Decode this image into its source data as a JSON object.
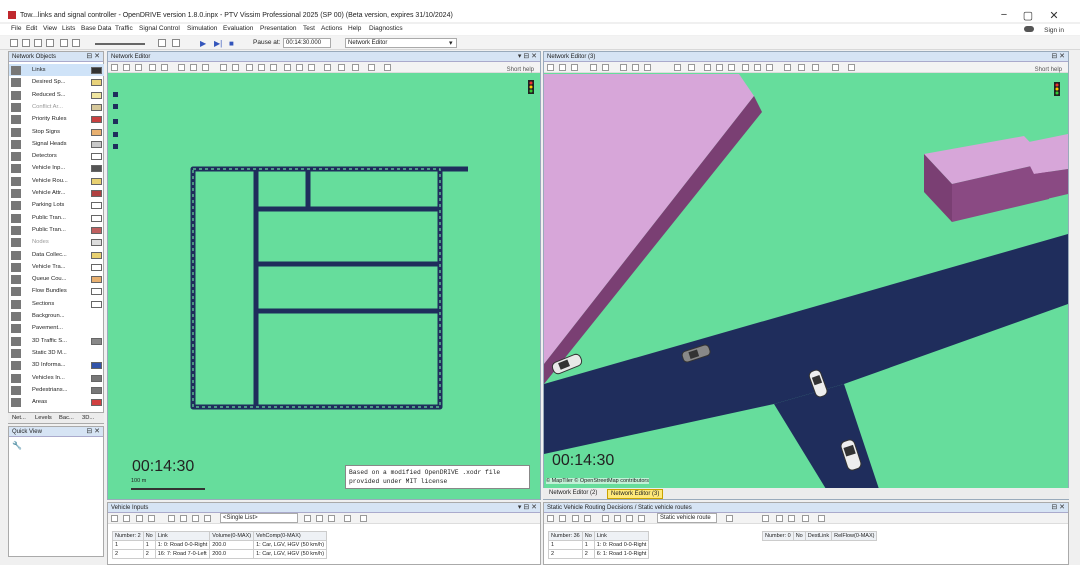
{
  "window": {
    "title": "Tow...links and signal controller - OpenDRIVE version 1.8.0.inpx - PTV Vissim Professional 2025 (SP 00) (Beta version, expires 31/10/2024)",
    "minimize": "−",
    "maximize": "▢",
    "close": "✕",
    "sign_in": "Sign in"
  },
  "menu": [
    "File",
    "Edit",
    "View",
    "Lists",
    "Base Data",
    "Traffic",
    "Signal Control",
    "Simulation",
    "Evaluation",
    "Presentation",
    "Test",
    "Actions",
    "Help",
    "Diagnostics"
  ],
  "toolbar": {
    "pause_label": "Pause at:",
    "pause_value": "00:14:30.000",
    "editor_select": "Network Editor"
  },
  "network_objects": {
    "title": "Network Objects",
    "items": [
      {
        "label": "Links",
        "swatch": "#333333",
        "icon": "links-icon",
        "selected": true
      },
      {
        "label": "Desired Sp...",
        "swatch": "#e8d27a",
        "icon": "desired-speed-icon"
      },
      {
        "label": "Reduced S...",
        "swatch": "#f0e6a0",
        "icon": "reduced-speed-icon"
      },
      {
        "label": "Conflict Ar...",
        "swatch": "#d6c89a",
        "icon": "conflict-area-icon",
        "dim": true
      },
      {
        "label": "Priority Rules",
        "swatch": "#c84040",
        "icon": "priority-rule-icon"
      },
      {
        "label": "Stop Signs",
        "swatch": "#e8b070",
        "icon": "stop-sign-icon"
      },
      {
        "label": "Signal Heads",
        "swatch": "#c8c8c8",
        "icon": "signal-head-icon"
      },
      {
        "label": "Detectors",
        "swatch": "#ffffff",
        "icon": "detector-icon"
      },
      {
        "label": "Vehicle Inp...",
        "swatch": "#555555",
        "icon": "vehicle-input-icon"
      },
      {
        "label": "Vehicle Rou...",
        "swatch": "#e8d070",
        "icon": "vehicle-route-icon"
      },
      {
        "label": "Vehicle Attr...",
        "swatch": "#b04040",
        "icon": "vehicle-attr-icon"
      },
      {
        "label": "Parking Lots",
        "swatch": "#ffffff",
        "icon": "parking-icon"
      },
      {
        "label": "Public Tran...",
        "swatch": "#ffffff",
        "icon": "public-transport-stop-icon"
      },
      {
        "label": "Public Tran...",
        "swatch": "#c06060",
        "icon": "public-transport-line-icon"
      },
      {
        "label": "Nodes",
        "swatch": "#dddddd",
        "icon": "nodes-icon",
        "dim": true
      },
      {
        "label": "Data Collec...",
        "swatch": "#e8d070",
        "icon": "data-collection-icon"
      },
      {
        "label": "Vehicle Tra...",
        "swatch": "#ffffff",
        "icon": "vehicle-travel-icon"
      },
      {
        "label": "Queue Cou...",
        "swatch": "#e8b070",
        "icon": "queue-counter-icon"
      },
      {
        "label": "Flow Bundles",
        "swatch": "#ffffff",
        "icon": "flow-bundle-icon"
      },
      {
        "label": "Sections",
        "swatch": "#ffffff",
        "icon": "sections-icon"
      },
      {
        "label": "Backgroun...",
        "swatch": "",
        "icon": "background-icon"
      },
      {
        "label": "Pavement...",
        "swatch": "",
        "icon": "pavement-icon"
      },
      {
        "label": "3D Traffic S...",
        "swatch": "#888888",
        "icon": "traffic-signal-3d-icon"
      },
      {
        "label": "Static 3D M...",
        "swatch": "",
        "icon": "static-3d-icon"
      },
      {
        "label": "3D Informa...",
        "swatch": "#3355aa",
        "icon": "info-3d-icon"
      },
      {
        "label": "Vehicles In...",
        "swatch": "#777777",
        "icon": "vehicles-in-network-icon"
      },
      {
        "label": "Pedestrians...",
        "swatch": "#777777",
        "icon": "pedestrians-icon"
      },
      {
        "label": "Areas",
        "swatch": "#d04040",
        "icon": "areas-icon"
      }
    ],
    "tabs": [
      "Net...",
      "Levels",
      "Bac...",
      "3D..."
    ]
  },
  "quick_view": {
    "title": "Quick View"
  },
  "network_editor_left": {
    "title": "Network Editor",
    "short_help": "Short help",
    "sim_time": "00:14:30",
    "scale": "100 m",
    "note_line1": "Based on a modified OpenDRIVE .xodr file",
    "note_line2": "provided under MIT license"
  },
  "network_editor_right": {
    "title": "Network Editor (3)",
    "short_help": "Short help",
    "sim_time": "00:14:30",
    "attribution": "© MapTiler  © OpenStreetMap contributors",
    "tabs": [
      {
        "label": "Network Editor (2)",
        "active": false
      },
      {
        "label": "Network Editor (3)",
        "active": true
      }
    ]
  },
  "vehicle_inputs": {
    "title": "Vehicle Inputs",
    "list_select": "<Single List>",
    "headers": [
      "Number: 2",
      "No",
      "Link",
      "Volume(0-MAX)",
      "VehComp(0-MAX)"
    ],
    "rows": [
      [
        "1",
        "1",
        "1: 0: Road 0-0-Right",
        "200.0",
        "1: Car, LGV, HGV (50 km/h)"
      ],
      [
        "2",
        "2",
        "16: 7: Road 7-0-Left",
        "200.0",
        "1: Car, LGV, HGV (50 km/h)"
      ]
    ]
  },
  "static_routing": {
    "title": "Static Vehicle Routing Decisions / Static vehicle routes",
    "list_select": "Static vehicle route",
    "headers": [
      "Number: 36",
      "No",
      "Link"
    ],
    "rows": [
      [
        "1",
        "1",
        "1: 0: Road 0-0-Right"
      ],
      [
        "2",
        "2",
        "6: 1: Road 1-0-Right"
      ]
    ],
    "sub_headers": [
      "Number: 0",
      "No",
      "DestLink",
      "RelFlow(0-MAX)"
    ]
  },
  "colors": {
    "grass": "#66dd9c",
    "road": "#1f2d5c",
    "building_roof": "#d7a6d9",
    "building_side": "#7a3f73"
  }
}
